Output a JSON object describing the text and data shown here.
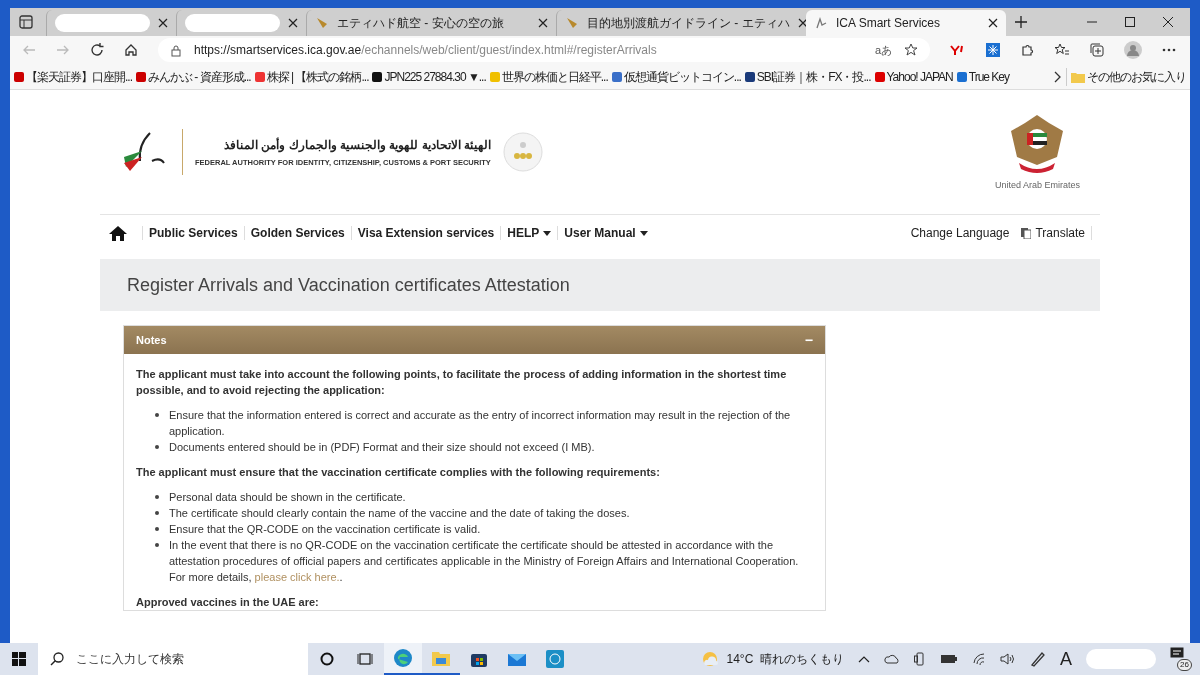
{
  "browser": {
    "tabs": [
      {
        "selected": false
      },
      {
        "selected": false
      },
      {
        "title": "エティハド航空 - 安心の空の旅",
        "selected": false
      },
      {
        "title": "目的地別渡航ガイドライン - エティハ",
        "selected": false
      },
      {
        "title": "ICA Smart Services",
        "selected": true
      }
    ],
    "address": {
      "host": "https://smartservices.ica.gov.ae",
      "path": "/echannels/web/client/guest/index.html#/registerArrivals"
    },
    "read_aloud": "aあ",
    "bookmarks": [
      {
        "label": "【楽天証券】口座開..."
      },
      {
        "label": "みんかぶ - 資産形成..."
      },
      {
        "label": "株探 | 【株式の銘柄..."
      },
      {
        "label": "JPN225 27884.30 ▼..."
      },
      {
        "label": "世界の株価と日経平..."
      },
      {
        "label": "仮想通貨ビットコイン..."
      },
      {
        "label": "SBI証券｜株・FX・投..."
      },
      {
        "label": "Yahoo! JAPAN"
      },
      {
        "label": "True Key"
      }
    ],
    "other_favorites": "その他のお気に入り"
  },
  "header": {
    "logo_arabic": "الهيئة الاتحادية للهوية والجنسية والجمارك وأمن المنافذ",
    "logo_english": "FEDERAL AUTHORITY FOR IDENTITY, CITIZENSHIP, CUSTOMS & PORT SECURITY",
    "emblem_caption": "United Arab Emirates"
  },
  "nav": {
    "items": [
      {
        "label": "Public Services",
        "dropdown": false
      },
      {
        "label": "Golden Services",
        "dropdown": false
      },
      {
        "label": "Visa Extension services",
        "dropdown": false
      },
      {
        "label": "HELP",
        "dropdown": true
      },
      {
        "label": "User Manual",
        "dropdown": true
      }
    ],
    "right": [
      {
        "label": "Change Language",
        "kind": "text"
      },
      {
        "label": "Translate",
        "kind": "icon"
      }
    ]
  },
  "page_title": "Register Arrivals and Vaccination certificates Attestation",
  "notes": {
    "title": "Notes",
    "collapse": "−",
    "blocks": [
      {
        "kind": "heading",
        "text": "The applicant must take into account the following points, to facilitate the process of adding information in the shortest time possible, and to avoid rejecting the application:"
      },
      {
        "kind": "list",
        "items": [
          "Ensure that the information entered is correct and accurate as the entry of incorrect information may result in the rejection of the application.",
          "Documents entered should be in (PDF) Format and their size should not exceed (I MB)."
        ]
      },
      {
        "kind": "heading",
        "text": "The applicant must ensure that the vaccination certificate complies with the following requirements:"
      },
      {
        "kind": "list",
        "items": [
          "Personal data should be shown in the certificate.",
          "The certificate should clearly contain the name of the vaccine and the date of taking the doses.",
          "Ensure that the QR-CODE on the vaccination certificate is valid.",
          "In the event that there is no QR-CODE on the vaccination certificate the certificate should be attested in accordance with the attestation procedures of official papers and certificates applicable in the Ministry of Foreign Affairs and International Cooperation. For more details, "
        ],
        "link": "please click here.",
        "tail": "."
      },
      {
        "kind": "heading",
        "text": "Approved vaccines in the UAE are:"
      }
    ]
  },
  "taskbar": {
    "search_placeholder": "ここに入力して検索",
    "weather": "14°C  晴れのちくもり",
    "ime": "A",
    "notifications": "26"
  }
}
